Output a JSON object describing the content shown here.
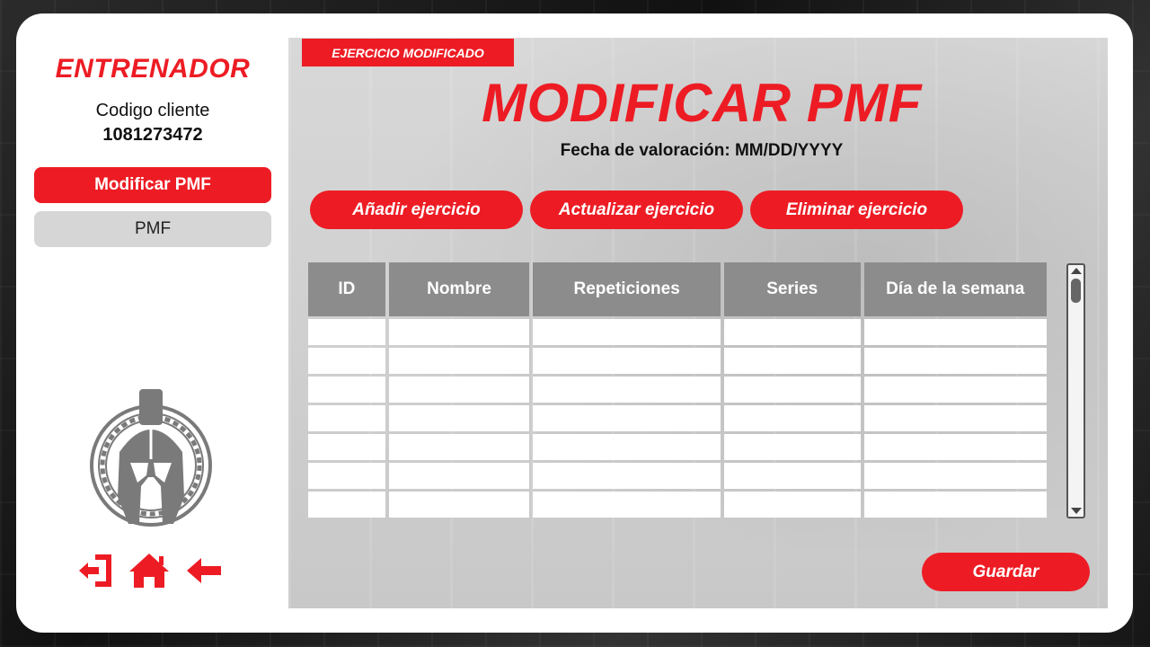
{
  "sidebar": {
    "role_title": "ENTRENADOR",
    "client_label": "Codigo cliente",
    "client_code": "1081273472",
    "nav": [
      {
        "label": "Modificar PMF",
        "active": true
      },
      {
        "label": "PMF",
        "active": false
      }
    ],
    "bottom_icons": [
      "logout-icon",
      "home-icon",
      "back-arrow-icon"
    ]
  },
  "main": {
    "toast": "EJERCICIO MODIFICADO",
    "title": "MODIFICAR PMF",
    "date_line": "Fecha de valoración: MM/DD/YYYY",
    "actions": [
      "Añadir ejercicio",
      "Actualizar ejercicio",
      "Eliminar ejercicio"
    ],
    "table": {
      "headers": [
        "ID",
        "Nombre",
        "Repeticiones",
        "Series",
        "Día de la semana"
      ],
      "rows": [
        [
          "",
          "",
          "",
          "",
          ""
        ],
        [
          "",
          "",
          "",
          "",
          ""
        ],
        [
          "",
          "",
          "",
          "",
          ""
        ],
        [
          "",
          "",
          "",
          "",
          ""
        ],
        [
          "",
          "",
          "",
          "",
          ""
        ],
        [
          "",
          "",
          "",
          "",
          ""
        ],
        [
          "",
          "",
          "",
          "",
          ""
        ]
      ]
    },
    "save_label": "Guardar"
  },
  "colors": {
    "accent": "#ed1c24",
    "header_gray": "#8c8c8c",
    "panel_gray": "#d2d2d2"
  }
}
